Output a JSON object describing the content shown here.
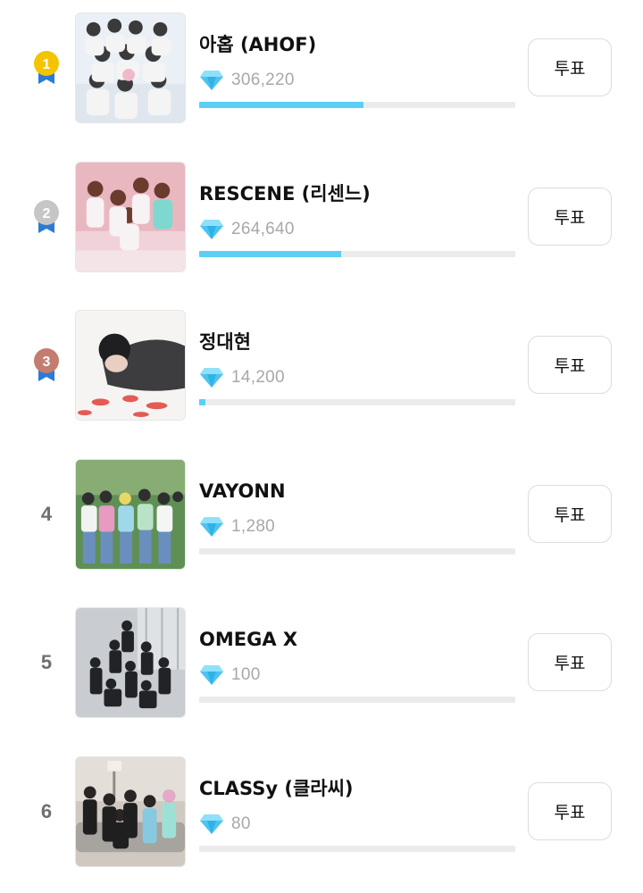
{
  "vote_button_label": "투표",
  "accent_color": "#5ccff2",
  "medal_colors": {
    "1": "#f5c400",
    "2": "#c6c6c6",
    "3": "#c47c6e",
    "ribbon": "#2a7bd6"
  },
  "rankings": [
    {
      "rank": "1",
      "name": "아홉 (AHOF)",
      "votes": "306,220",
      "progress": 0.52,
      "medal": "gold",
      "thumb": "group-photo-white-outfits"
    },
    {
      "rank": "2",
      "name": "RESCENE (리센느)",
      "votes": "264,640",
      "progress": 0.45,
      "medal": "silver",
      "thumb": "group-photo-pink-room"
    },
    {
      "rank": "3",
      "name": "정대현",
      "votes": "14,200",
      "progress": 0.02,
      "medal": "bronze",
      "thumb": "solo-portrait"
    },
    {
      "rank": "4",
      "name": "VAYONN",
      "votes": "1,280",
      "progress": 0.0,
      "medal": null,
      "thumb": "group-photo-outdoor"
    },
    {
      "rank": "5",
      "name": "OMEGA X",
      "votes": "100",
      "progress": 0.0,
      "medal": null,
      "thumb": "group-photo-grey-studio"
    },
    {
      "rank": "6",
      "name": "CLASSy (클라씨)",
      "votes": "80",
      "progress": 0.0,
      "medal": null,
      "thumb": "group-photo-living-room"
    }
  ]
}
